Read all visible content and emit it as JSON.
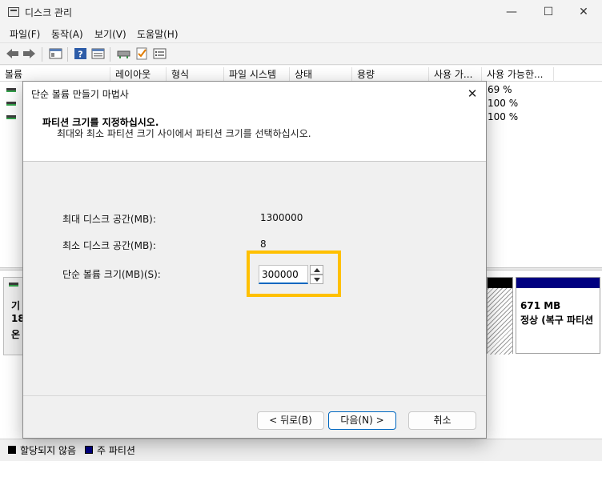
{
  "window": {
    "title": "디스크 관리",
    "minimize_glyph": "—",
    "maximize_glyph": "☐",
    "close_glyph": "✕"
  },
  "menu": [
    "파일(F)",
    "동작(A)",
    "보기(V)",
    "도움말(H)"
  ],
  "toolbar_icons": [
    "back-arrow-icon",
    "forward-arrow-icon",
    "console-tree-icon",
    "help-icon",
    "properties-icon",
    "connect-drive-icon",
    "check-icon",
    "list-icon"
  ],
  "columns": [
    "볼륨",
    "레이아웃",
    "형식",
    "파일 시스템",
    "상태",
    "용량",
    "사용 가...",
    "사용 가능한..."
  ],
  "volumes": [
    {
      "free_pct": "69 %"
    },
    {
      "free_pct": "100 %"
    },
    {
      "free_pct": "100 %"
    }
  ],
  "disk": {
    "label_lines": [
      "기",
      "18",
      "온"
    ],
    "recovery_size": "671 MB",
    "recovery_status": "정상 (복구 파티션"
  },
  "legend": {
    "unallocated": "할당되지 않음",
    "primary": "주 파티션",
    "unallocated_color": "#000000",
    "primary_color": "#000080"
  },
  "dialog": {
    "title": "단순 볼륨 만들기 마법사",
    "close_glyph": "✕",
    "heading": "파티션 크기를 지정하십시오.",
    "subheading": "최대와 최소 파티션 크기 사이에서 파티션 크기를 선택하십시오.",
    "max_label": "최대 디스크 공간(MB):",
    "max_value": "1300000",
    "min_label": "최소 디스크 공간(MB):",
    "min_value": "8",
    "size_label": "단순 볼륨 크기(MB)(S):",
    "size_value": "300000",
    "back_button": "< 뒤로(B)",
    "next_button": "다음(N) >",
    "cancel_button": "취소",
    "highlight_color": "#ffc000"
  }
}
